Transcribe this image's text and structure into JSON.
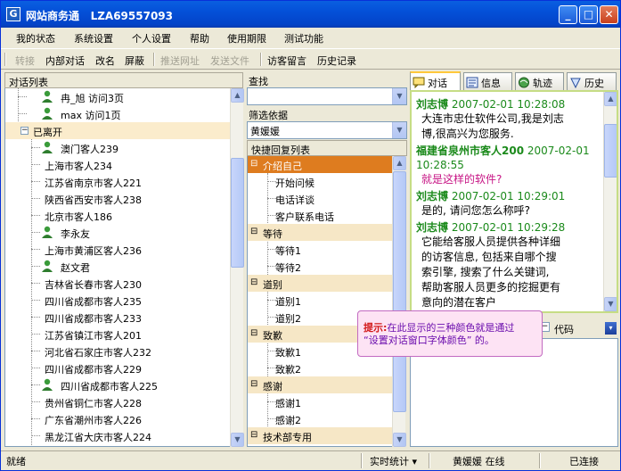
{
  "window": {
    "app_title": "网站商务通",
    "account": "LZA69557093",
    "app_icon": "G",
    "controls": {
      "minimize": "_",
      "maximize": "□",
      "close": "✕"
    }
  },
  "menubar": [
    "我的状态",
    "系统设置",
    "个人设置",
    "帮助",
    "使用期限",
    "测试功能"
  ],
  "toolbar": {
    "items": [
      "转接",
      "内部对话",
      "改名",
      "屏蔽",
      "推送网址",
      "发送文件",
      "访客留言",
      "历史记录"
    ],
    "disabled": [
      "转接",
      "推送网址",
      "发送文件"
    ]
  },
  "left_panel": {
    "header": "对话列表",
    "online": [
      {
        "name": "冉_旭",
        "visits": "访问3页",
        "has_icon": true
      },
      {
        "name": "max",
        "visits": "访问1页",
        "has_icon": true
      }
    ],
    "group_left": "已离开",
    "left_visitors": [
      {
        "name": "澳门客人239",
        "has_icon": true
      },
      {
        "name": "上海市客人234",
        "has_icon": false
      },
      {
        "name": "江苏省南京市客人221",
        "has_icon": false
      },
      {
        "name": "陕西省西安市客人238",
        "has_icon": false
      },
      {
        "name": "北京市客人186",
        "has_icon": false
      },
      {
        "name": "李永友",
        "has_icon": true
      },
      {
        "name": "上海市黄浦区客人236",
        "has_icon": false
      },
      {
        "name": "赵文君",
        "has_icon": true
      },
      {
        "name": "吉林省长春市客人230",
        "has_icon": false
      },
      {
        "name": "四川省成都市客人235",
        "has_icon": false
      },
      {
        "name": "四川省成都市客人233",
        "has_icon": false
      },
      {
        "name": "江苏省镇江市客人201",
        "has_icon": false
      },
      {
        "name": "河北省石家庄市客人232",
        "has_icon": false
      },
      {
        "name": "四川省成都市客人229",
        "has_icon": false
      },
      {
        "name": "四川省成都市客人225",
        "has_icon": true
      },
      {
        "name": "贵州省铜仁市客人228",
        "has_icon": false
      },
      {
        "name": "广东省潮州市客人226",
        "has_icon": false
      },
      {
        "name": "黑龙江省大庆市客人224",
        "has_icon": false
      }
    ]
  },
  "middle_panel": {
    "search_label": "查找",
    "search_value": "",
    "filter_label": "筛选依据",
    "filter_value": "黄媛媛",
    "quick_reply_header": "快捷回复列表",
    "groups": [
      {
        "title": "介绍自己",
        "active": true,
        "items": [
          "开始问候",
          "电话详谈",
          "客户联系电话"
        ]
      },
      {
        "title": "等待",
        "active": false,
        "items": [
          "等待1",
          "等待2"
        ]
      },
      {
        "title": "道别",
        "active": false,
        "items": [
          "道别1",
          "道别2"
        ]
      },
      {
        "title": "致歉",
        "active": false,
        "items": [
          "致歉1",
          "致歉2"
        ]
      },
      {
        "title": "感谢",
        "active": false,
        "items": [
          "感谢1",
          "感谢2"
        ]
      },
      {
        "title": "技术部专用",
        "active": false,
        "items": []
      }
    ]
  },
  "right_panel": {
    "tabs": [
      {
        "label": "对话",
        "icon": "chat-icon",
        "active": true
      },
      {
        "label": "信息",
        "icon": "info-icon",
        "active": false
      },
      {
        "label": "轨迹",
        "icon": "track-icon",
        "active": false
      },
      {
        "label": "历史",
        "icon": "history-icon",
        "active": false
      }
    ],
    "messages": [
      {
        "sender": "刘志博",
        "time": "2007-02-01 10:28:08",
        "lines": [
          "大连市忠仕软件公司,我是刘志",
          "博,很高兴为您服务."
        ],
        "style": "agent"
      },
      {
        "sender": "福建省泉州市客人200",
        "time": "2007-02-01 10:28:55",
        "lines": [
          "就是这样的软件?"
        ],
        "style": "visitor"
      },
      {
        "sender": "刘志博",
        "time": "2007-02-01 10:29:01",
        "lines": [
          "是的, 请问您怎么称呼?"
        ],
        "style": "agent"
      },
      {
        "sender": "刘志博",
        "time": "2007-02-01 10:29:28",
        "lines": [
          "它能给客服人员提供各种详细",
          "的访客信息, 包括来自哪个搜",
          "索引擎, 搜索了什么关键词,",
          "帮助客服人员更多的挖掘更有",
          "意向的潜在客户"
        ],
        "style": "agent"
      }
    ],
    "input_toolbar_label": "代码"
  },
  "tooltip": {
    "key": "提示:",
    "text": "在此显示的三种颜色就是通过",
    "text2": "“设置对话窗口字体颜色” 的。"
  },
  "statusbar": {
    "status": "就绪",
    "realtime": "实时统计",
    "realtime_arrow": "▾",
    "user": "黄媛媛",
    "user_state": "在线",
    "connection": "已连接"
  },
  "colors": {
    "title_bar": "#0450d8",
    "active_group": "#de7c1f",
    "group_bg": "#f6e7c6",
    "sender_green": "#1b8a1b",
    "visitor_pink": "#c71585",
    "tooltip_bg": "#fde3f4"
  }
}
